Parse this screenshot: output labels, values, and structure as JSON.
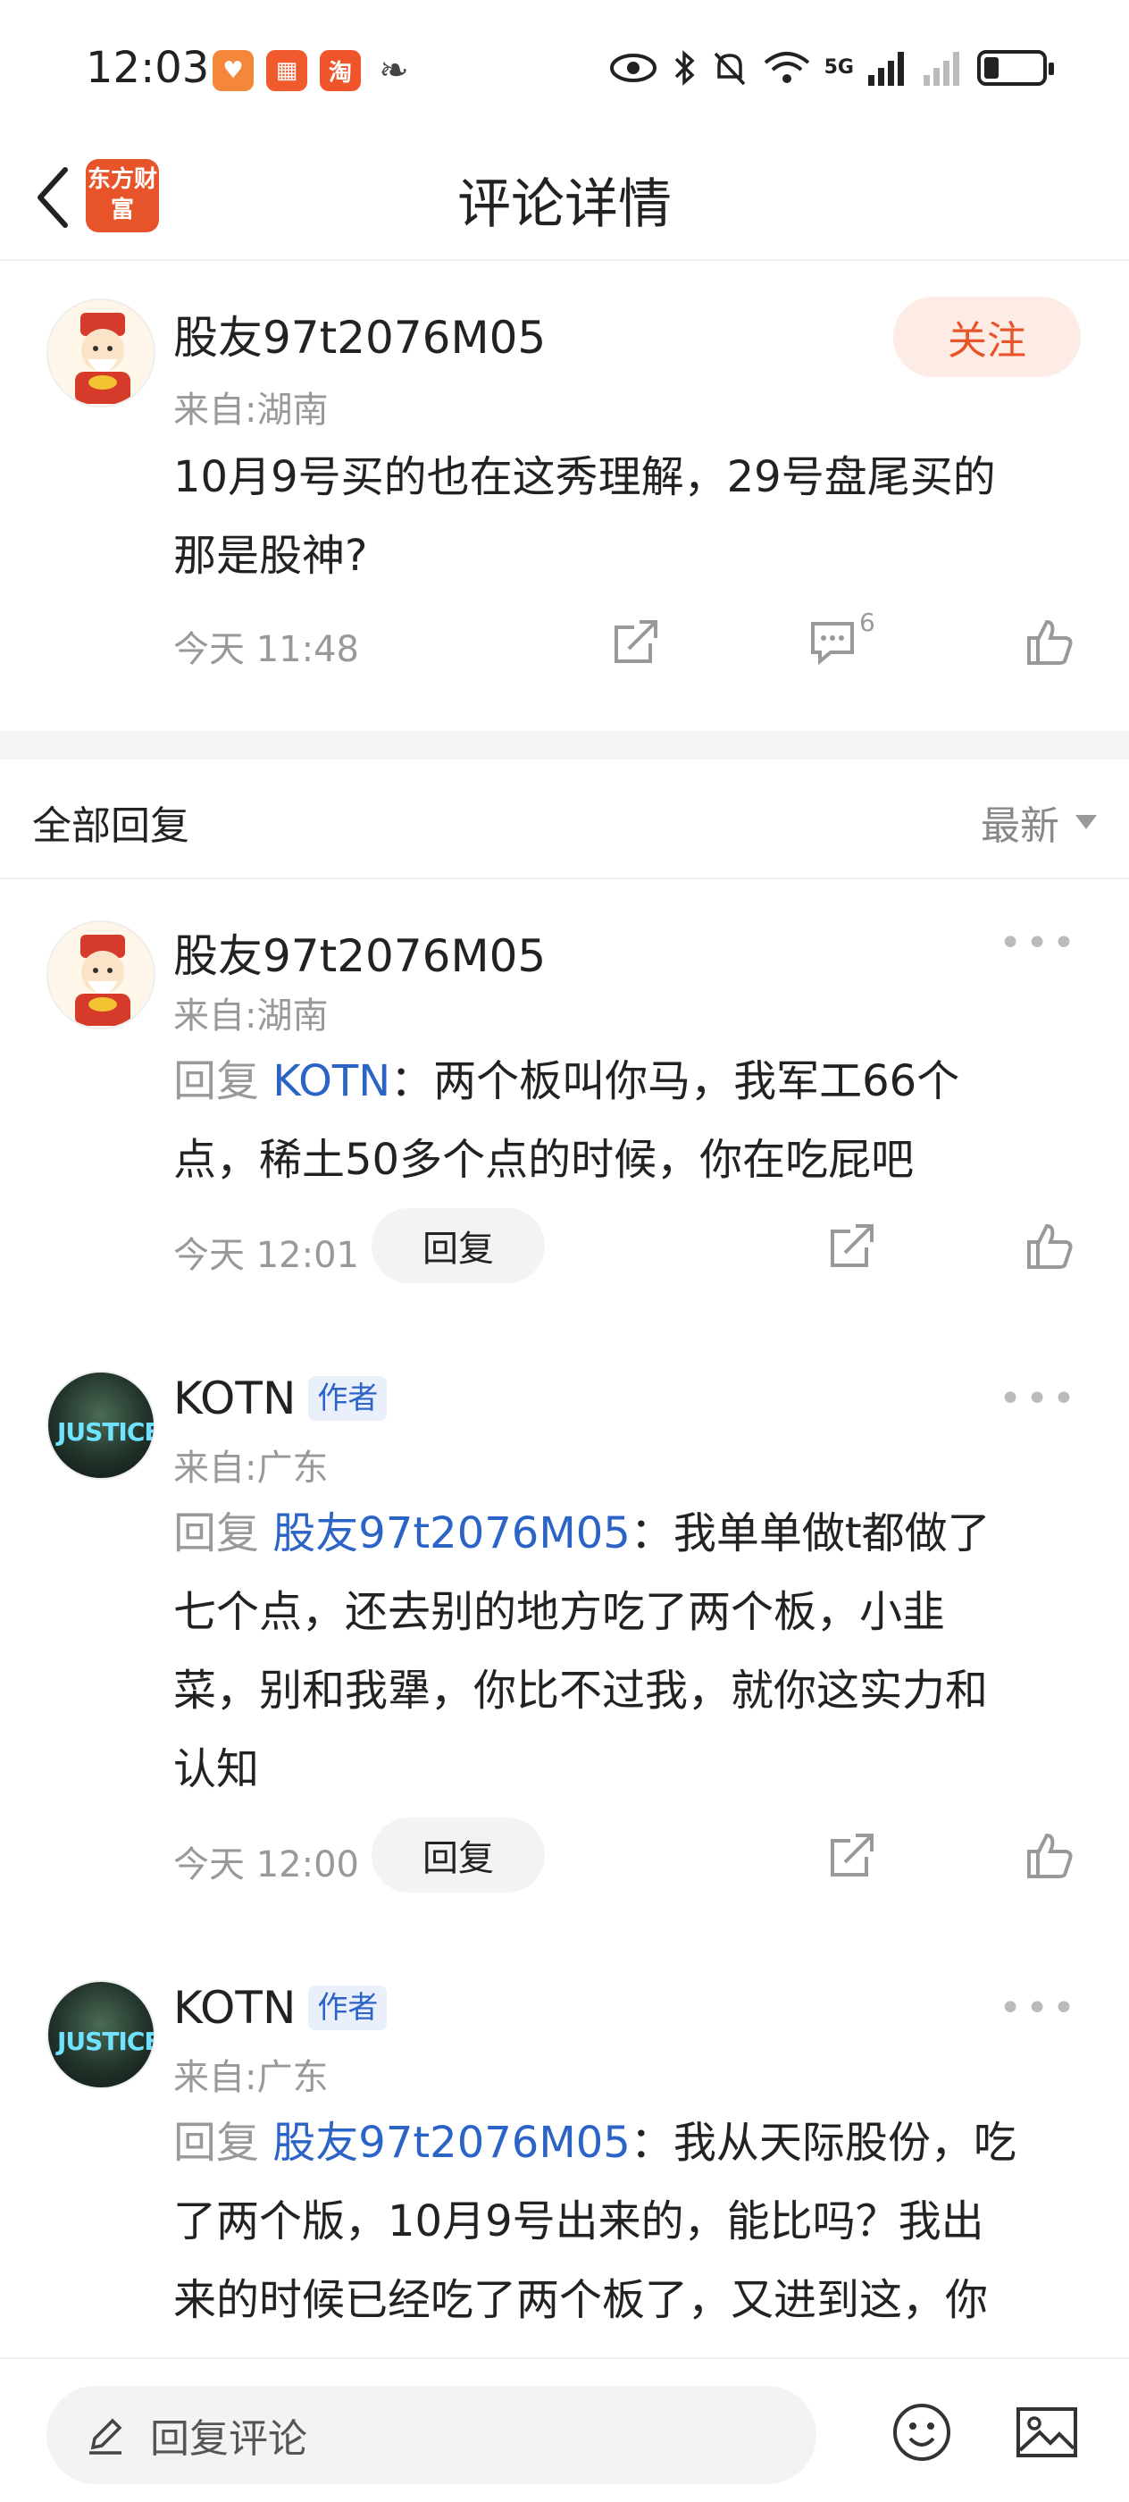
{
  "status_bar": {
    "time": "12:03",
    "network": "5G",
    "app_icons": [
      {
        "icon": "heart-app-icon",
        "color": "#f5873a"
      },
      {
        "icon": "grid-app-icon",
        "color": "#f05a2c"
      },
      {
        "icon": "taobao-app-icon",
        "text": "淘",
        "color": "#f0542a"
      },
      {
        "icon": "leaf-app-icon",
        "color": "#444444"
      }
    ]
  },
  "header": {
    "title": "评论详情",
    "logo_text": "东方财富"
  },
  "main_comment": {
    "username": "股友97t2076M05",
    "location": "来自:湖南",
    "follow_label": "关注",
    "text_line1": "10月9号买的也在这秀理解，29号盘尾买的",
    "text_line2": "那是股神?",
    "time": "今天 11:48",
    "reply_count": "6"
  },
  "replies_section": {
    "title": "全部回复",
    "sort_label": "最新"
  },
  "replies": [
    {
      "username": "股友97t2076M05",
      "location": "来自:湖南",
      "reply_prefix": "回复",
      "reply_to": "KOTN",
      "text_line1": "：两个板叫你马，我军工66个",
      "text_line2": "点，稀土50多个点的时候，你在吃屁吧",
      "time": "今天 12:01",
      "reply_btn": "回复"
    },
    {
      "username": "KOTN",
      "author_tag": "作者",
      "location": "来自:广东",
      "reply_prefix": "回复",
      "reply_to": "股友97t2076M05",
      "text_line1": "：我单单做t都做了",
      "text_line2": "七个点，还去别的地方吃了两个板，小韭",
      "text_line3": "菜，别和我犟，你比不过我，就你这实力和",
      "text_line4": "认知",
      "time": "今天 12:00",
      "reply_btn": "回复"
    },
    {
      "username": "KOTN",
      "author_tag": "作者",
      "location": "来自:广东",
      "reply_prefix": "回复",
      "reply_to": "股友97t2076M05",
      "text_line1": "：我从天际股份，吃",
      "text_line2": "了两个版，10月9号出来的，能比吗？我出",
      "text_line3": "来的时候已经吃了两个板了，又进到这，你"
    }
  ],
  "bottom_bar": {
    "input_placeholder": "回复评论"
  },
  "avatar_text": {
    "kotn": "JUSTICE"
  },
  "colors": {
    "accent": "#e8542a",
    "link": "#2b63c6",
    "muted": "#999999"
  }
}
